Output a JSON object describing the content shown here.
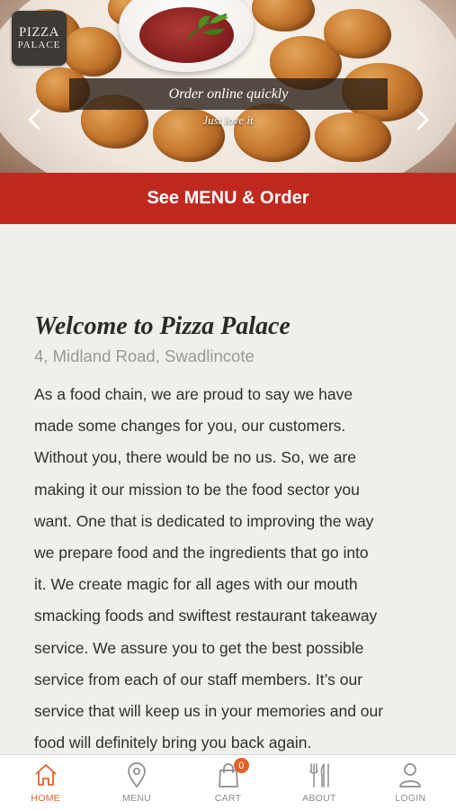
{
  "logo": {
    "line1": "PIZZA",
    "line2": "PALACE"
  },
  "slider": {
    "title": "Order online quickly",
    "subtitle": "Just love it"
  },
  "cta": {
    "label": "See MENU & Order"
  },
  "content": {
    "heading": "Welcome to Pizza Palace",
    "address": "4, Midland Road, Swadlincote",
    "lines": [
      "As a food chain, we are proud to say we have",
      "made some changes for you, our customers.",
      "Without you, there would be no us. So, we are",
      "making it our mission to be the food sector you",
      "want. One that is dedicated to improving the way",
      "we prepare food and the ingredients that go into",
      "it. We create magic for all ages with our mouth",
      "smacking foods and swiftest restaurant takeaway",
      "service. We assure you to get the best possible",
      "service from each of our staff members. It’s our",
      "service that will keep us in your memories and our",
      "food will definitely bring you back again."
    ]
  },
  "tabs": [
    {
      "label": "HOME",
      "icon": "home-icon",
      "active": true
    },
    {
      "label": "MENU",
      "icon": "location-pin-icon",
      "active": false
    },
    {
      "label": "CART",
      "icon": "shopping-bag-icon",
      "active": false,
      "badge": "0"
    },
    {
      "label": "ABOUT",
      "icon": "cutlery-icon",
      "active": false
    },
    {
      "label": "LOGIN",
      "icon": "user-icon",
      "active": false
    }
  ],
  "colors": {
    "accent_red": "#c1291f",
    "tab_active": "#e2622c",
    "tab_inactive": "#8c8c8c",
    "background": "#f1efe9"
  }
}
